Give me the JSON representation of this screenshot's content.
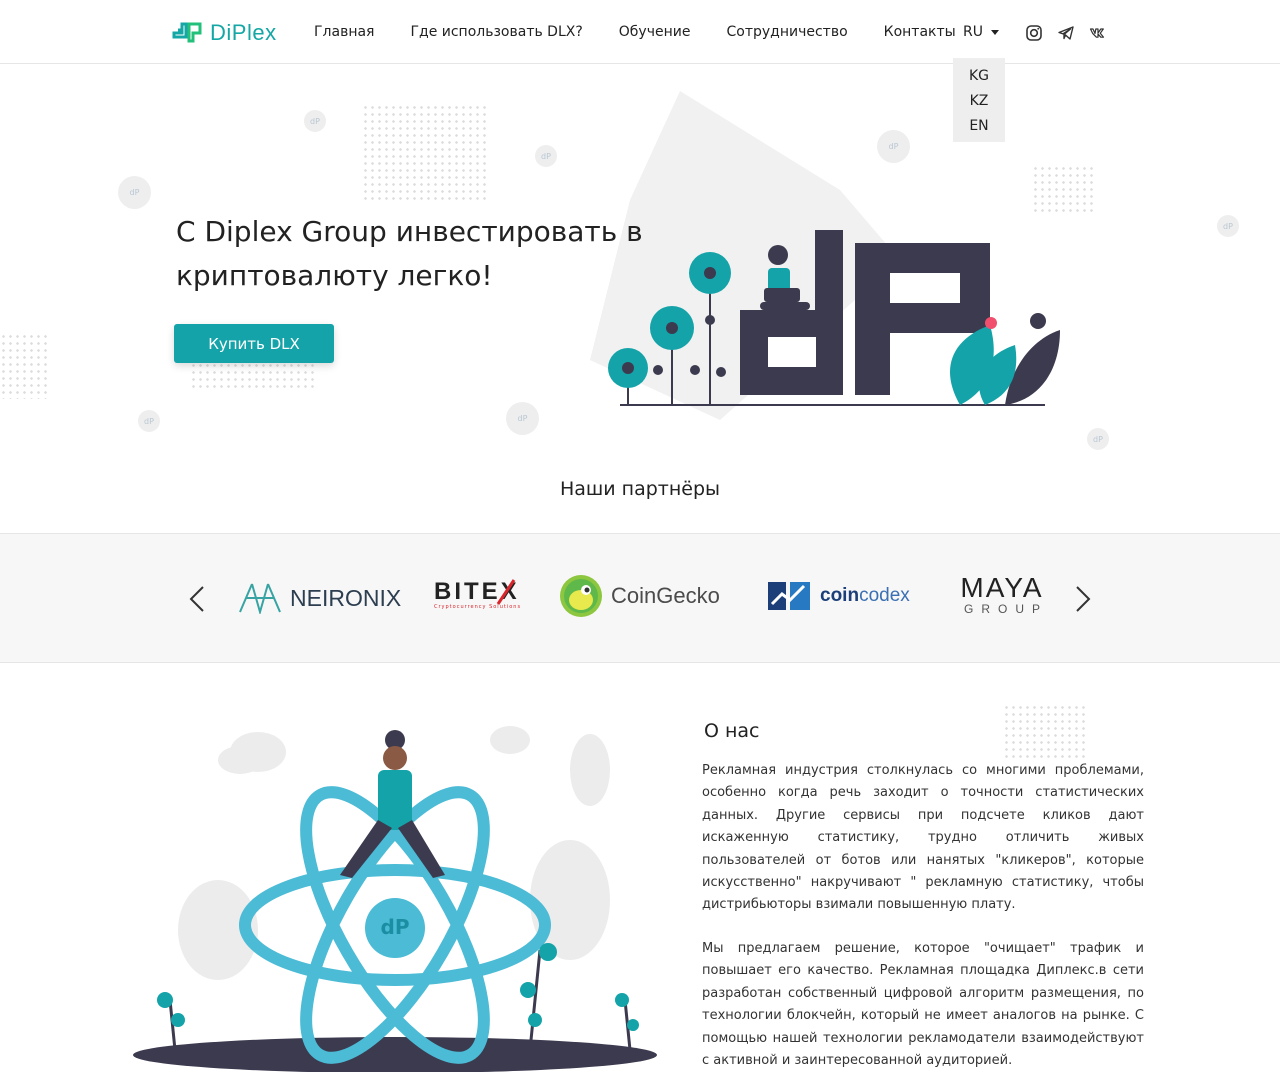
{
  "brand": {
    "name": "DiPlex",
    "accent": "#14a3a8",
    "dark": "#3c3a4e"
  },
  "nav": {
    "items": [
      {
        "label": "Главная"
      },
      {
        "label": "Где использовать DLX?"
      },
      {
        "label": "Обучение"
      },
      {
        "label": "Сотрудничество"
      },
      {
        "label": "Контакты"
      }
    ]
  },
  "language": {
    "current": "RU",
    "options": [
      "KG",
      "KZ",
      "EN"
    ]
  },
  "social": [
    "instagram-icon",
    "telegram-icon",
    "vk-icon"
  ],
  "hero": {
    "title": "С Diplex Group инвестировать в криптовалюту легко!",
    "button": "Купить DLX"
  },
  "partners": {
    "title": "Наши партнёры",
    "logos": [
      {
        "name": "NEIRONIX"
      },
      {
        "name": "BITEX",
        "tagline": "Cryptocurrency Solutions"
      },
      {
        "name": "CoinGecko"
      },
      {
        "name_bold": "coin",
        "name_light": "codex"
      },
      {
        "name": "MAYA",
        "sub": "GROUP"
      }
    ]
  },
  "about": {
    "title": "О нас",
    "paragraphs": [
      "Рекламная индустрия столкнулась со многими проблемами, особенно когда речь заходит о точности статистических данных. Другие сервисы при подсчете кликов дают искаженную статистику, трудно отличить живых пользователей от ботов или нанятых \"кликеров\", которые искусственно\" накручивают \" рекламную статистику, чтобы дистрибьюторы взимали повышенную плату.",
      "Мы предлагаем решение, которое \"очищает\" трафик и повышает его качество. Рекламная площадка Диплекс.в сети разработан собственный цифровой алгоритм размещения, по технологии блокчейн, который не имеет аналогов на рынке. С помощью нашей технологии рекламодатели взаимодействуют с активной и заинтересованной аудиторией."
    ]
  }
}
